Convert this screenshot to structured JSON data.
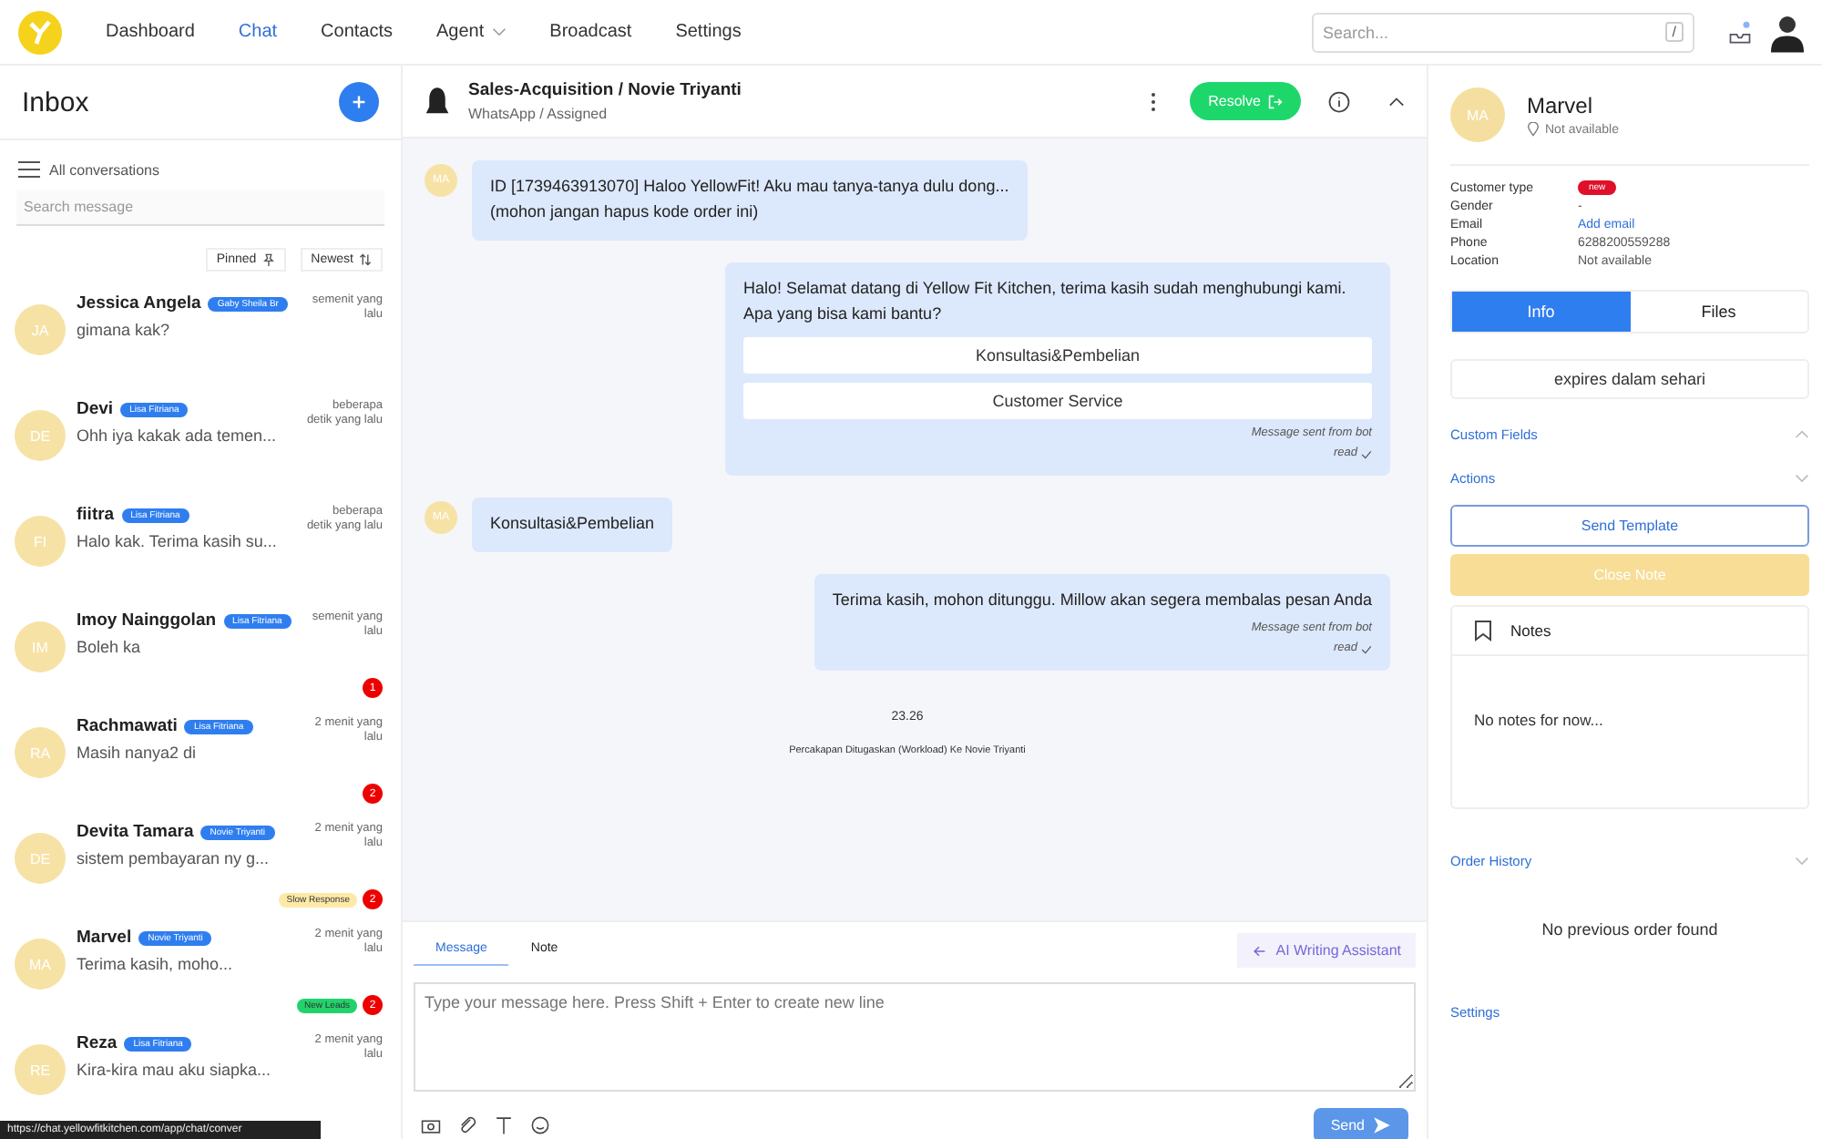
{
  "nav": {
    "items": [
      {
        "label": "Dashboard",
        "selected": false,
        "dropdown": false
      },
      {
        "label": "Chat",
        "selected": true,
        "dropdown": false
      },
      {
        "label": "Contacts",
        "selected": false,
        "dropdown": false
      },
      {
        "label": "Agent",
        "selected": false,
        "dropdown": true
      },
      {
        "label": "Broadcast",
        "selected": false,
        "dropdown": false
      },
      {
        "label": "Settings",
        "selected": false,
        "dropdown": false
      }
    ],
    "search": {
      "placeholder": "Search...",
      "shortcut": "/"
    }
  },
  "inbox": {
    "title": "Inbox",
    "filter": "All conversations",
    "search_placeholder": "Search message",
    "pinned": "Pinned",
    "sort": "Newest",
    "conversations": [
      {
        "initials": "JA",
        "name": "Jessica Angela",
        "agent": "Gaby Sheila Br",
        "preview": "gimana kak?",
        "time": "semenit yang lalu"
      },
      {
        "initials": "DE",
        "name": "Devi",
        "agent": "Lisa Fitriana",
        "preview": "Ohh iya kakak ada temen...",
        "time": "beberapa detik yang lalu"
      },
      {
        "initials": "FI",
        "name": "fiitra",
        "agent": "Lisa Fitriana",
        "preview": "Halo kak. Terima kasih su...",
        "time": "beberapa detik yang lalu"
      },
      {
        "initials": "IM",
        "name": "Imoy Nainggolan",
        "agent": "Lisa Fitriana",
        "preview": "Boleh ka",
        "time": "semenit yang lalu",
        "unread": "1"
      },
      {
        "initials": "RA",
        "name": "Rachmawati",
        "agent": "Lisa Fitriana",
        "preview": "Masih nanya2 di",
        "time": "2 menit yang lalu",
        "unread": "2"
      },
      {
        "initials": "DE",
        "name": "Devita Tamara",
        "agent": "Novie Triyanti",
        "preview": "sistem pembayaran ny g...",
        "time": "2 menit yang lalu",
        "unread": "2",
        "tag": "Slow Response",
        "color": "#fde9a8"
      },
      {
        "initials": "MA",
        "name": "Marvel",
        "agent": "Novie Triyanti",
        "preview": "Terima kasih, moho...",
        "time": "2 menit yang lalu",
        "unread": "2",
        "tag": "New Leads",
        "color": "#22d36b"
      },
      {
        "initials": "RE",
        "name": "Reza",
        "agent": "Lisa Fitriana",
        "preview": "Kira-kira mau aku siapka...",
        "time": "2 menit yang lalu"
      }
    ]
  },
  "chat": {
    "title": "Sales-Acquisition / Novie Triyanti",
    "subtitle": "WhatsApp / Assigned",
    "resolve": "Resolve",
    "messages": [
      {
        "kind": "incoming",
        "initials": "MA",
        "text": "ID [1739463913070] Haloo YellowFit! Aku mau tanya-tanya dulu dong... (mohon jangan hapus kode order ini)"
      },
      {
        "kind": "outgoing",
        "text": "Halo! Selamat datang di Yellow Fit Kitchen, terima kasih sudah menghubungi kami. Apa yang bisa kami bantu?",
        "options": [
          "Konsultasi&Pembelian",
          "Customer Service"
        ],
        "footer": "Message sent from bot",
        "status": "read"
      },
      {
        "kind": "incoming",
        "initials": "MA",
        "text": "Konsultasi&Pembelian"
      },
      {
        "kind": "outgoing",
        "text": "Terima kasih, mohon ditunggu. Millow akan segera membalas pesan Anda",
        "footer": "Message sent from bot",
        "status": "read"
      },
      {
        "kind": "system",
        "time": "23.26",
        "text": "Percakapan Ditugaskan (Workload) Ke Novie Triyanti"
      }
    ],
    "composer": {
      "tabs": [
        {
          "label": "Message",
          "selected": true
        },
        {
          "label": "Note",
          "selected": false
        }
      ],
      "assistant": "AI Writing Assistant",
      "placeholder": "Type your message here. Press Shift + Enter to create new line",
      "send": "Send"
    }
  },
  "contact": {
    "initials": "MA",
    "name": "Marvel",
    "status": "Not available",
    "fields": [
      {
        "label": "Customer type",
        "value": "new",
        "kind": "badge"
      },
      {
        "label": "Gender",
        "value": "-",
        "kind": "text"
      },
      {
        "label": "Email",
        "value": "Add email",
        "kind": "link"
      },
      {
        "label": "Phone",
        "value": "6288200559288",
        "kind": "text"
      },
      {
        "label": "Location",
        "value": "Not available",
        "kind": "text"
      }
    ],
    "tabs": [
      {
        "label": "Info",
        "selected": true
      },
      {
        "label": "Files",
        "selected": false
      }
    ],
    "expiry": "expires dalam sehari",
    "custom_fields": "Custom Fields",
    "actions": "Actions",
    "send_template": "Send Template",
    "close_note": "Close Note",
    "notes_title": "Notes",
    "notes_empty": "No notes for now...",
    "order_history": "Order History",
    "order_empty": "No previous order found",
    "settings": "Settings"
  },
  "status_url": "https://chat.yellowfitkitchen.com/app/chat/conver"
}
